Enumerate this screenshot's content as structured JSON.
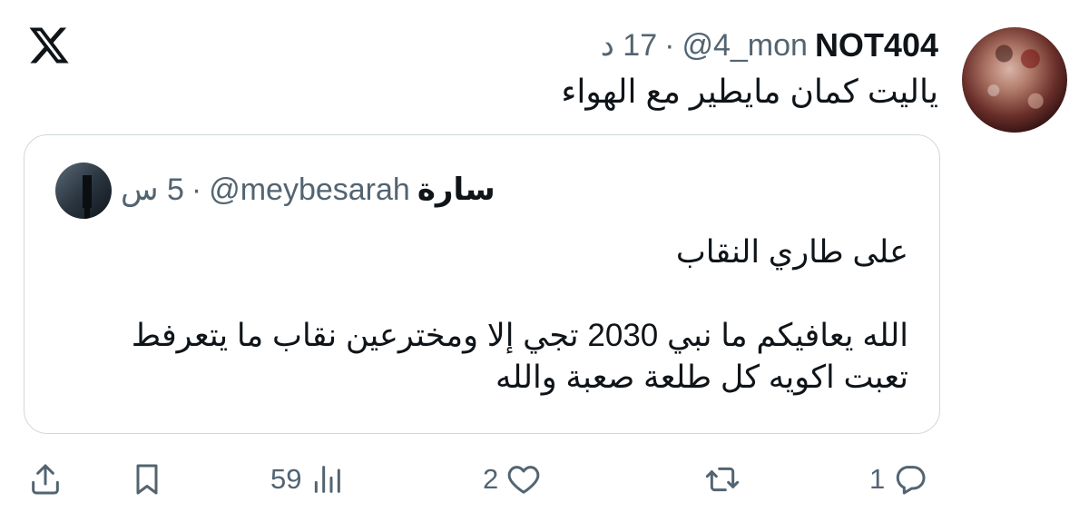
{
  "post": {
    "author_name": "NOT404",
    "author_handle": "@4_mon",
    "separator": "·",
    "time": "17 د",
    "text": "ياليت كمان مايطير مع الهواء"
  },
  "quote": {
    "author_name": "سارة",
    "author_handle": "@meybesarah",
    "separator": "·",
    "time": "5 س",
    "line1": "على طاري النقاب",
    "line2": "الله يعافيكم ما نبي 2030 تجي إلا ومخترعين نقاب ما يتعرفط",
    "line3": "تعبت اكويه كل طلعة صعبة والله"
  },
  "actions": {
    "views_count": "59",
    "likes_count": "2",
    "retweets_count": "",
    "replies_count": "1"
  },
  "icons": {
    "logo": "x-logo-icon",
    "share": "share-icon",
    "bookmark": "bookmark-icon",
    "views": "views-icon",
    "like": "heart-icon",
    "retweet": "retweet-icon",
    "reply": "reply-icon"
  },
  "colors": {
    "text_primary": "#0f1419",
    "text_secondary": "#536471",
    "border": "#cfd9de"
  }
}
